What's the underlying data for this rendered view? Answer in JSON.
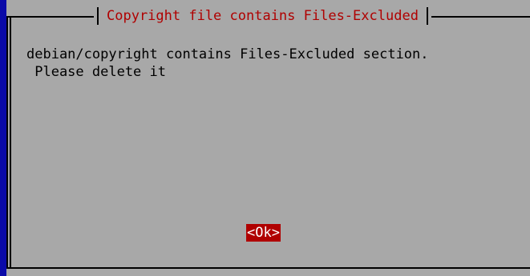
{
  "dialog": {
    "title": "Copyright file contains Files-Excluded",
    "message_line1": "debian/copyright contains Files-Excluded section.",
    "message_line2": " Please delete it",
    "ok_label": "<Ok>"
  },
  "colors": {
    "background": "#a8a8a8",
    "title_text": "#b00000",
    "button_bg": "#b00000",
    "button_text": "#ffffff",
    "terminal_blue": "#0a0aa8"
  }
}
